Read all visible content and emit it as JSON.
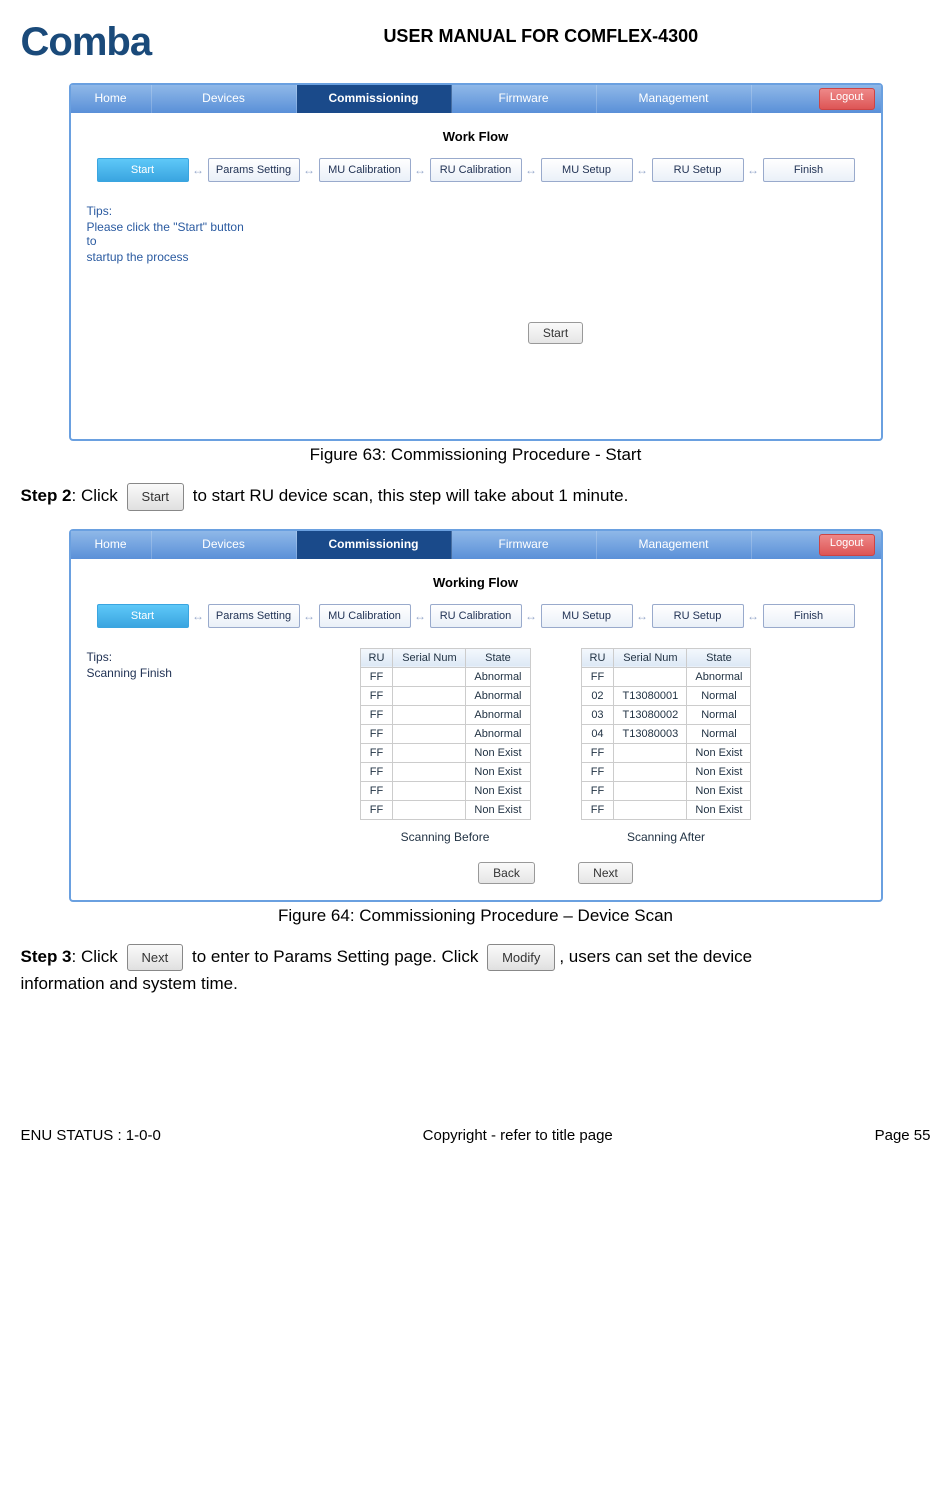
{
  "header": {
    "logo": "Comba",
    "manual_title": "USER MANUAL FOR COMFLEX-4300"
  },
  "nav": {
    "items": [
      "Home",
      "Devices",
      "Commissioning",
      "Firmware",
      "Management"
    ],
    "logout": "Logout"
  },
  "fig63": {
    "title": "Work Flow",
    "steps": [
      "Start",
      "Params Setting",
      "MU Calibration",
      "RU Calibration",
      "MU Setup",
      "RU Setup",
      "Finish"
    ],
    "tips_title": "Tips:",
    "tips_body1": "Please click the \"Start\" button to",
    "tips_body2": "startup the process",
    "start_btn": "Start",
    "caption": "Figure 63: Commissioning Procedure - Start"
  },
  "step2": {
    "label": "Step 2",
    "pre": ": Click",
    "btn": "Start",
    "post": "to start RU device scan, this step will take about 1 minute."
  },
  "fig64": {
    "title": "Working Flow",
    "tips_title": "Tips:",
    "tips_body": "Scanning Finish",
    "headers": [
      "RU",
      "Serial Num",
      "State"
    ],
    "before_rows": [
      [
        "FF",
        "",
        "Abnormal"
      ],
      [
        "FF",
        "",
        "Abnormal"
      ],
      [
        "FF",
        "",
        "Abnormal"
      ],
      [
        "FF",
        "",
        "Abnormal"
      ],
      [
        "FF",
        "",
        "Non Exist"
      ],
      [
        "FF",
        "",
        "Non Exist"
      ],
      [
        "FF",
        "",
        "Non Exist"
      ],
      [
        "FF",
        "",
        "Non Exist"
      ]
    ],
    "after_rows": [
      [
        "FF",
        "",
        "Abnormal"
      ],
      [
        "02",
        "T13080001",
        "Normal"
      ],
      [
        "03",
        "T13080002",
        "Normal"
      ],
      [
        "04",
        "T13080003",
        "Normal"
      ],
      [
        "FF",
        "",
        "Non Exist"
      ],
      [
        "FF",
        "",
        "Non Exist"
      ],
      [
        "FF",
        "",
        "Non Exist"
      ],
      [
        "FF",
        "",
        "Non Exist"
      ]
    ],
    "before_label": "Scanning Before",
    "after_label": "Scanning After",
    "back_btn": "Back",
    "next_btn": "Next",
    "caption": "Figure 64: Commissioning Procedure – Device Scan"
  },
  "step3": {
    "label": "Step 3",
    "pre": ": Click",
    "btn1": "Next",
    "mid": "to enter to Params Setting page. Click",
    "btn2": "Modify",
    "post1": ", users can set the device",
    "post2": "information and system time."
  },
  "footer": {
    "left": "ENU STATUS : 1-0-0",
    "center": "Copyright - refer to title page",
    "right": "Page 55"
  }
}
